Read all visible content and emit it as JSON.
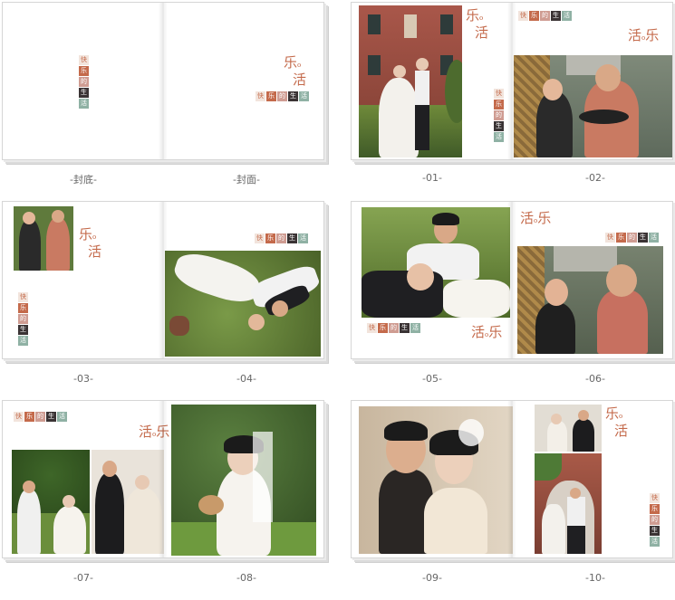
{
  "captions": [
    "-封底-",
    "-封面-",
    "-01-",
    "-02-",
    "-03-",
    "-04-",
    "-05-",
    "-06-",
    "-07-",
    "-08-",
    "-09-",
    "-10-"
  ],
  "chips": [
    "快",
    "乐",
    "的",
    "生",
    "活"
  ],
  "chip_colors": [
    "#f2e4dc",
    "#c46a4b",
    "#cf9c92",
    "#3a3334",
    "#8fb1a4"
  ],
  "title_a": [
    "乐",
    "活"
  ],
  "title_b": [
    "活",
    "乐"
  ],
  "colors": {
    "accent": "#c46a4b",
    "caption": "#666666"
  }
}
